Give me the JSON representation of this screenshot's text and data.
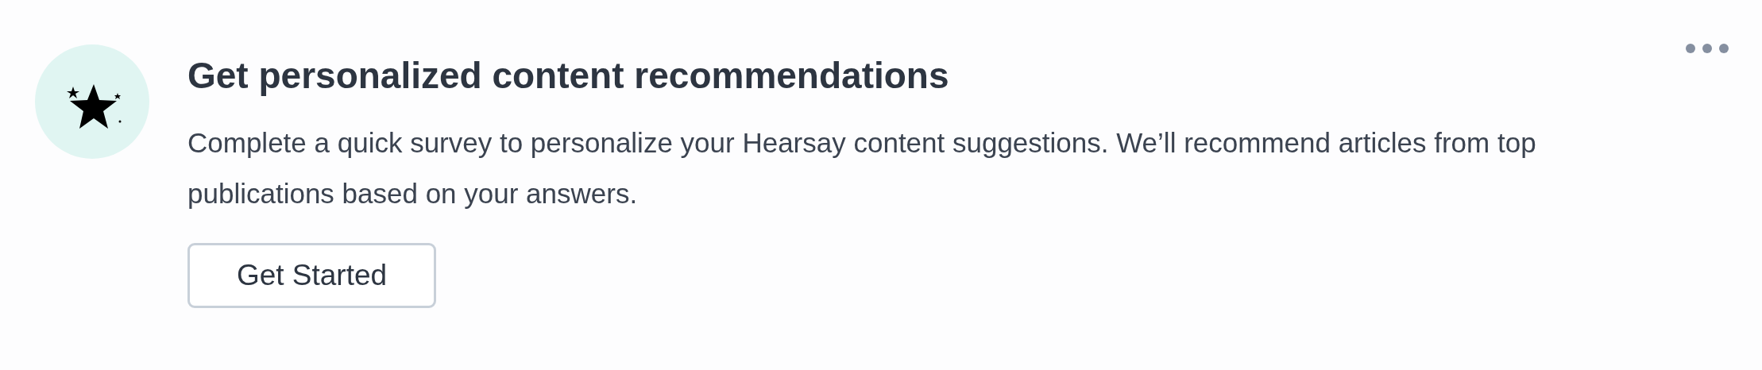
{
  "card": {
    "title": "Get personalized content recommendations",
    "description": "Complete a quick survey to personalize your Hearsay content suggestions. We’ll recommend articles from top publications based on your answers.",
    "button": "Get Started"
  }
}
